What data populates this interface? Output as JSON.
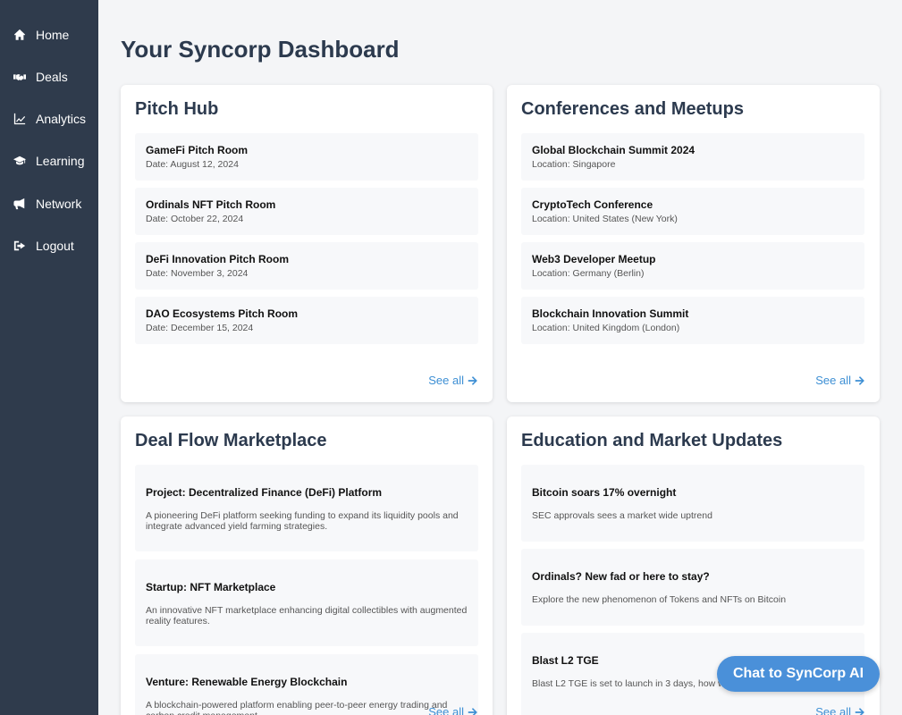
{
  "sidebar": {
    "items": [
      {
        "label": "Home",
        "icon": "home-icon"
      },
      {
        "label": "Deals",
        "icon": "handshake-icon"
      },
      {
        "label": "Analytics",
        "icon": "chart-line-icon"
      },
      {
        "label": "Learning",
        "icon": "graduation-cap-icon"
      },
      {
        "label": "Network",
        "icon": "megaphone-icon"
      },
      {
        "label": "Logout",
        "icon": "sign-out-icon"
      }
    ]
  },
  "main": {
    "title": "Your Syncorp Dashboard",
    "pitch_hub": {
      "title": "Pitch Hub",
      "items": [
        {
          "title": "GameFi Pitch Room",
          "sub": "Date: August 12, 2024"
        },
        {
          "title": "Ordinals NFT Pitch Room",
          "sub": "Date: October 22, 2024"
        },
        {
          "title": "DeFi Innovation Pitch Room",
          "sub": "Date: November 3, 2024"
        },
        {
          "title": "DAO Ecosystems Pitch Room",
          "sub": "Date: December 15, 2024"
        }
      ],
      "see_all": "See all"
    },
    "conferences": {
      "title": "Conferences and Meetups",
      "items": [
        {
          "title": "Global Blockchain Summit 2024",
          "sub": "Location: Singapore"
        },
        {
          "title": "CryptoTech Conference",
          "sub": "Location: United States (New York)"
        },
        {
          "title": "Web3 Developer Meetup",
          "sub": "Location: Germany (Berlin)"
        },
        {
          "title": "Blockchain Innovation Summit",
          "sub": "Location: United Kingdom (London)"
        }
      ],
      "see_all": "See all"
    },
    "deal_flow": {
      "title": "Deal Flow Marketplace",
      "items": [
        {
          "title": "Project: Decentralized Finance (DeFi) Platform",
          "sub": "A pioneering DeFi platform seeking funding to expand its liquidity pools and integrate advanced yield farming strategies."
        },
        {
          "title": "Startup: NFT Marketplace",
          "sub": "An innovative NFT marketplace enhancing digital collectibles with augmented reality features."
        },
        {
          "title": "Venture: Renewable Energy Blockchain",
          "sub": "A blockchain-powered platform enabling peer-to-peer energy trading and carbon credit management."
        }
      ],
      "see_all": "See all"
    },
    "education": {
      "title": "Education and Market Updates",
      "items": [
        {
          "title": "Bitcoin soars 17% overnight",
          "sub": "SEC approvals sees a market wide uptrend"
        },
        {
          "title": "Ordinals? New fad or here to stay?",
          "sub": "Explore the new phenomenon of Tokens and NFTs on Bitcoin"
        },
        {
          "title": "Blast L2 TGE",
          "sub": "Blast L2 TGE is set to launch in 3 days, how will the market conditions?"
        }
      ],
      "see_all": "See all"
    }
  },
  "chat_button": "Chat to SynCorp AI",
  "colors": {
    "sidebar_bg": "#2f3b4c",
    "accent": "#3d8fd4",
    "chat_bg": "#4a90d9",
    "heading": "#2c3a4e"
  }
}
